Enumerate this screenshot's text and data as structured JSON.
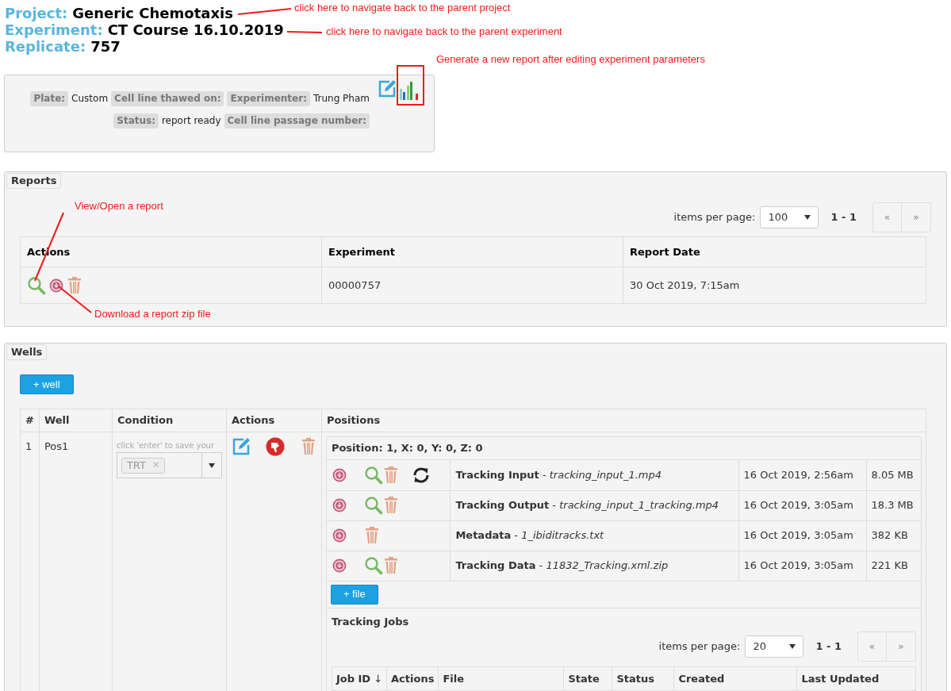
{
  "header": [
    {
      "label": "Project:",
      "value": "Generic Chemotaxis"
    },
    {
      "label": "Experiment:",
      "value": "CT Course 16.10.2019"
    },
    {
      "label": "Replicate:",
      "value": "757"
    }
  ],
  "info": {
    "fields": [
      {
        "label": "Plate:",
        "value": "Custom"
      },
      {
        "label": "Cell line thawed on:"
      },
      {
        "label": "Experimenter:",
        "value": "Trung Pham"
      },
      {
        "label": "Status:",
        "value": "report ready"
      },
      {
        "label": "Cell line passage number:"
      }
    ],
    "tools": [
      {
        "kind": "edit"
      },
      {
        "kind": "chart"
      }
    ]
  },
  "reports": {
    "title": "Reports",
    "items_per_page_label": "items per page:",
    "items_per_page": "100",
    "range": "1 - 1",
    "pager": [
      "«",
      "»"
    ],
    "columns": [
      "Actions",
      "Experiment",
      "Report Date"
    ],
    "rows": [
      {
        "actions": [
          {
            "kind": "view"
          },
          {
            "kind": "download"
          },
          {
            "kind": "delete"
          }
        ],
        "experiment": "00000757",
        "date": "30 Oct 2019, 7:15am"
      }
    ]
  },
  "wells": {
    "title": "Wells",
    "add_button": "+ well",
    "columns": [
      "#",
      "Well",
      "Condition",
      "Actions",
      "Positions"
    ],
    "rows": [
      {
        "index": "1",
        "name": "Pos1",
        "condition_hint": "click 'enter' to save your",
        "condition_tags": [
          {
            "text": "TRT",
            "remove": "×"
          }
        ],
        "actions": [
          {
            "kind": "edit"
          },
          {
            "kind": "thumbs-down"
          },
          {
            "kind": "delete"
          }
        ],
        "position": {
          "title": "Position: 1, X: 0, Y: 0, Z: 0",
          "files": [
            {
              "actions": [
                {
                  "kind": "download"
                },
                {
                  "kind": "view"
                },
                {
                  "kind": "delete"
                },
                {
                  "kind": "refresh"
                }
              ],
              "name": "**Tracking Input** - *tracking_input_1.mp4*",
              "date": "16 Oct 2019, 2:56am",
              "size": "8.05 MB"
            },
            {
              "actions": [
                {
                  "kind": "download"
                },
                {
                  "kind": "view"
                },
                {
                  "kind": "delete"
                }
              ],
              "name": "**Tracking Output** - *tracking_input_1_tracking.mp4*",
              "date": "16 Oct 2019, 3:05am",
              "size": "18.3 MB"
            },
            {
              "actions": [
                {
                  "kind": "download"
                },
                {
                  "kind": "delete"
                }
              ],
              "name": "**Metadata** - *1_ibiditracks.txt*",
              "date": "16 Oct 2019, 3:05am",
              "size": "382 KB"
            },
            {
              "actions": [
                {
                  "kind": "download"
                },
                {
                  "kind": "view"
                },
                {
                  "kind": "delete"
                }
              ],
              "name": "**Tracking Data** - *11832_Tracking.xml.zip*",
              "date": "16 Oct 2019, 3:05am",
              "size": "221 KB"
            }
          ],
          "add_button": "+ file",
          "jobs": {
            "title": "Tracking Jobs",
            "items_per_page_label": "items per page:",
            "items_per_page": "20",
            "range": "1 - 1",
            "pager": [
              "«",
              "»"
            ],
            "columns": [
              {
                "label": "Job ID",
                "sort_mark": "↓"
              },
              {
                "label": "Actions"
              },
              {
                "label": "File"
              },
              {
                "label": "State"
              },
              {
                "label": "Status"
              },
              {
                "label": "Created"
              },
              {
                "label": "Last Updated"
              }
            ]
          }
        }
      }
    ]
  },
  "annotations": [
    {
      "text": "click here to navigate back to the parent project",
      "kind": "line"
    },
    {
      "text": "click here to navigate back to the parent experiment",
      "kind": "line"
    },
    {
      "text": "Generate a new report after editing experiment parameters",
      "kind": "frame"
    },
    {
      "text": "View/Open a report",
      "kind": "line"
    },
    {
      "text": "Download a report zip file",
      "kind": "line"
    }
  ]
}
